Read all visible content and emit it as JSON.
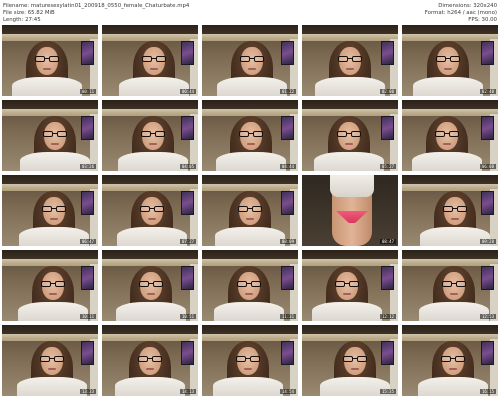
{
  "header": {
    "filename": "Filename: maturesexylatin01_200918_0550_female_Chaturbate.mp4",
    "file_size": "File size: 65.82 MiB",
    "length": "Length: 27:45",
    "dimensions": "Dimensions: 320x240",
    "format": "Format: h264 / aac (mono)",
    "fps": "FPS: 30.00"
  },
  "thumbnails": [
    {
      "timestamp": "00:11"
    },
    {
      "timestamp": "00:44"
    },
    {
      "timestamp": "01:22"
    },
    {
      "timestamp": "02:00"
    },
    {
      "timestamp": "02:40"
    },
    {
      "timestamp": "03:26"
    },
    {
      "timestamp": "04:05"
    },
    {
      "timestamp": "04:44"
    },
    {
      "timestamp": "05:27"
    },
    {
      "timestamp": "06:08"
    },
    {
      "timestamp": "06:47"
    },
    {
      "timestamp": "07:27"
    },
    {
      "timestamp": "08:09"
    },
    {
      "timestamp": "08:47"
    },
    {
      "timestamp": "09:28"
    },
    {
      "timestamp": "10:11"
    },
    {
      "timestamp": "10:51"
    },
    {
      "timestamp": "11:31"
    },
    {
      "timestamp": "12:12"
    },
    {
      "timestamp": "12:53"
    },
    {
      "timestamp": "13:33"
    },
    {
      "timestamp": "14:13"
    },
    {
      "timestamp": "14:54"
    },
    {
      "timestamp": "15:35"
    },
    {
      "timestamp": "16:15"
    }
  ]
}
